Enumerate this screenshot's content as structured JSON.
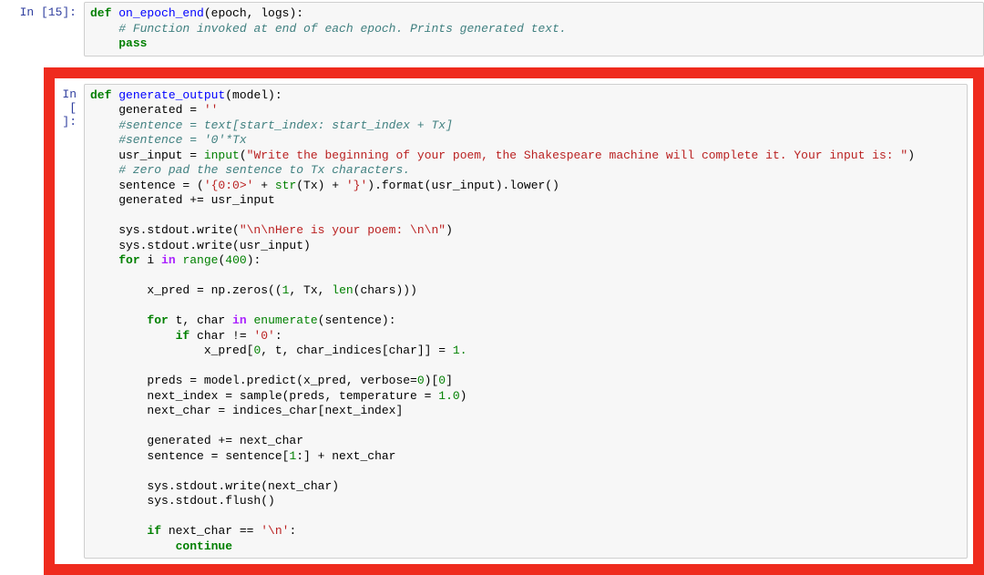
{
  "cell15": {
    "prompt": "In [15]:",
    "line1_def": "def",
    "line1_name": "on_epoch_end",
    "line1_rest": "(epoch, logs):",
    "line2_comment": "# Function invoked at end of each epoch. Prints generated text.",
    "line3_pass": "pass"
  },
  "cellX": {
    "prompt": "In [ ]:",
    "def": "def",
    "fname": "generate_output",
    "fparams": "(model):",
    "l_gen_eq": "    generated = ",
    "l_gen_str": "''",
    "l_c1": "    #sentence = text[start_index: start_index + Tx]",
    "l_c2": "    #sentence = '0'*Tx",
    "l_usr_a": "    usr_input = ",
    "l_usr_bi": "input",
    "l_usr_p1": "(",
    "l_usr_str": "\"Write the beginning of your poem, the Shakespeare machine will complete it. Your input is: \"",
    "l_usr_p2": ")",
    "l_c3": "    # zero pad the sentence to Tx characters.",
    "l_sent_a": "    sentence = (",
    "l_sent_s1": "'{0:0>'",
    "l_sent_b": " + ",
    "l_sent_bi": "str",
    "l_sent_c": "(Tx) + ",
    "l_sent_s2": "'}'",
    "l_sent_d": ").format(usr_input).lower()",
    "l_gena": "    generated += usr_input",
    "blank": "",
    "l_w1a": "    sys.stdout.write(",
    "l_w1s": "\"\\n\\nHere is your poem: \\n\\n\"",
    "l_w1b": ")",
    "l_w2": "    sys.stdout.write(usr_input)",
    "l_for": "for",
    "l_for_a": "    ",
    "l_for_b": " i ",
    "l_in": "in",
    "l_for_c": " ",
    "l_range": "range",
    "l_for_d": "(",
    "l_400": "400",
    "l_for_e": "):",
    "l_xp_a": "        x_pred = np.zeros((",
    "l_xp_n1": "1",
    "l_xp_b": ", Tx, ",
    "l_len": "len",
    "l_xp_c": "(chars)))",
    "l_for2_a": "        ",
    "l_for2_b": " t, char ",
    "l_for2_c": " ",
    "l_enum": "enumerate",
    "l_for2_d": "(sentence):",
    "l_if_a": "            ",
    "l_if": "if",
    "l_if_b": " char != ",
    "l_if_s": "'0'",
    "l_if_c": ":",
    "l_xpi_a": "                x_pred[",
    "l_xpi_n0": "0",
    "l_xpi_b": ", t, char_indices[char]] = ",
    "l_xpi_n1": "1.",
    "l_pred_a": "        preds = model.predict(x_pred, verbose=",
    "l_pred_n0": "0",
    "l_pred_b": ")[",
    "l_pred_n1": "0",
    "l_pred_c": "]",
    "l_ni_a": "        next_index = sample(preds, temperature = ",
    "l_ni_n": "1.0",
    "l_ni_b": ")",
    "l_nc": "        next_char = indices_char[next_index]",
    "l_g2": "        generated += next_char",
    "l_s2a": "        sentence = sentence[",
    "l_s2n": "1",
    "l_s2b": ":] + next_char",
    "l_w3": "        sys.stdout.write(next_char)",
    "l_w4": "        sys.stdout.flush()",
    "l_if2_a": "        ",
    "l_if2_b": " next_char == ",
    "l_if2_s": "'\\n'",
    "l_if2_c": ":",
    "l_cont_a": "            ",
    "l_cont": "continue"
  }
}
